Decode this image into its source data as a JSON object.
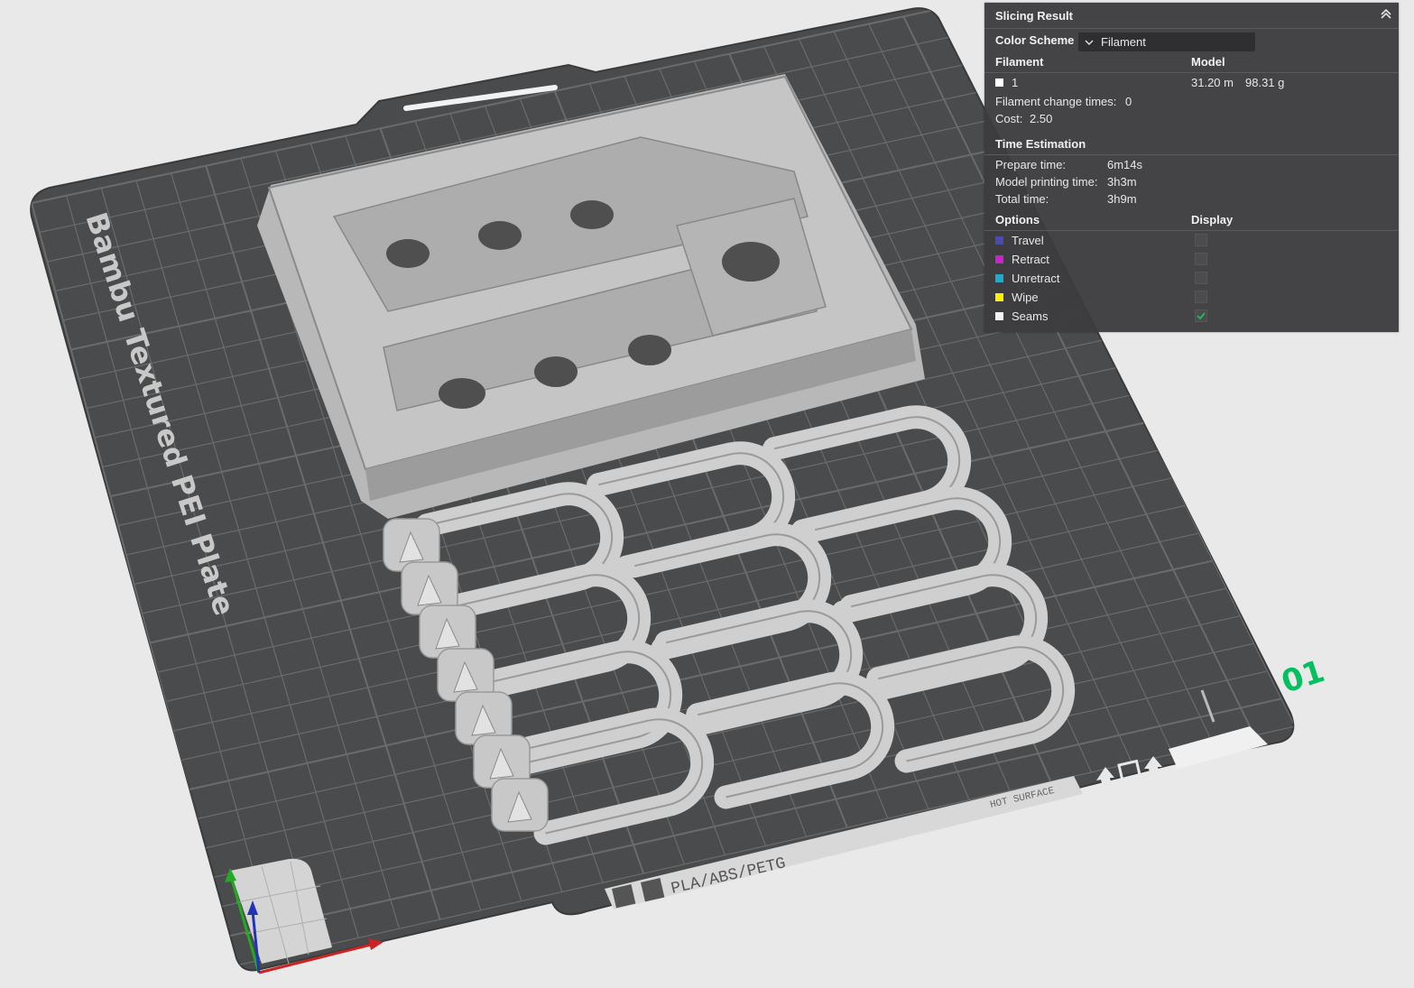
{
  "bed": {
    "plate_name": "Bambu Textured PEI Plate",
    "plate_number": "01",
    "material_label": "PLA/ABS/PETG",
    "hot_surface_label": "HOT SURFACE"
  },
  "panel": {
    "title": "Slicing Result",
    "color_scheme_label": "Color Scheme",
    "color_scheme_value": "Filament",
    "filament_header": "Filament",
    "model_header": "Model",
    "filament_row": {
      "index": "1",
      "length": "31.20 m",
      "weight": "98.31 g",
      "color": "#ffffff"
    },
    "filament_change_label": "Filament change times:",
    "filament_change_value": "0",
    "cost_label": "Cost:",
    "cost_value": "2.50",
    "time_header": "Time Estimation",
    "prepare_label": "Prepare time:",
    "prepare_value": "6m14s",
    "model_time_label": "Model printing time:",
    "model_time_value": "3h3m",
    "total_label": "Total time:",
    "total_value": "3h9m",
    "options_header": "Options",
    "display_header": "Display",
    "options": [
      {
        "label": "Travel",
        "color": "#4a4ab0",
        "checked": false
      },
      {
        "label": "Retract",
        "color": "#cc22cc",
        "checked": false
      },
      {
        "label": "Unretract",
        "color": "#22aacc",
        "checked": false
      },
      {
        "label": "Wipe",
        "color": "#ffee00",
        "checked": false
      },
      {
        "label": "Seams",
        "color": "#f2f2f2",
        "checked": true
      }
    ]
  },
  "colors": {
    "plate_number": "#00c060",
    "axis_x": "#cc2222",
    "axis_y": "#22aa22",
    "axis_z": "#2233bb"
  }
}
